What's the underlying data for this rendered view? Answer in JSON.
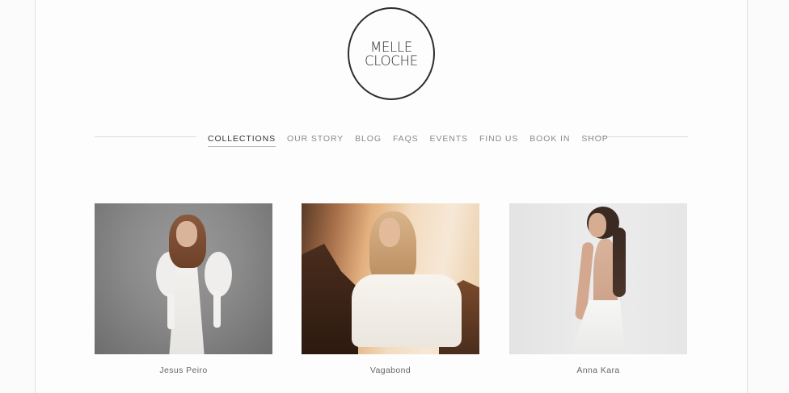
{
  "brand": {
    "logo_line1": "MELLE",
    "logo_line2": "CLOCHE"
  },
  "nav": {
    "items": [
      {
        "label": "COLLECTIONS",
        "active": true
      },
      {
        "label": "OUR STORY",
        "active": false
      },
      {
        "label": "BLOG",
        "active": false
      },
      {
        "label": "FAQS",
        "active": false
      },
      {
        "label": "EVENTS",
        "active": false
      },
      {
        "label": "FIND US",
        "active": false
      },
      {
        "label": "BOOK IN",
        "active": false
      },
      {
        "label": "SHOP",
        "active": false
      }
    ]
  },
  "collections": [
    {
      "name": "Jesus Peiro"
    },
    {
      "name": "Vagabond"
    },
    {
      "name": "Anna Kara"
    }
  ],
  "colors": {
    "background": "#fbfbfb",
    "text": "#555555",
    "active_nav": "#333333",
    "logo_ring": "#2d2d2d"
  }
}
